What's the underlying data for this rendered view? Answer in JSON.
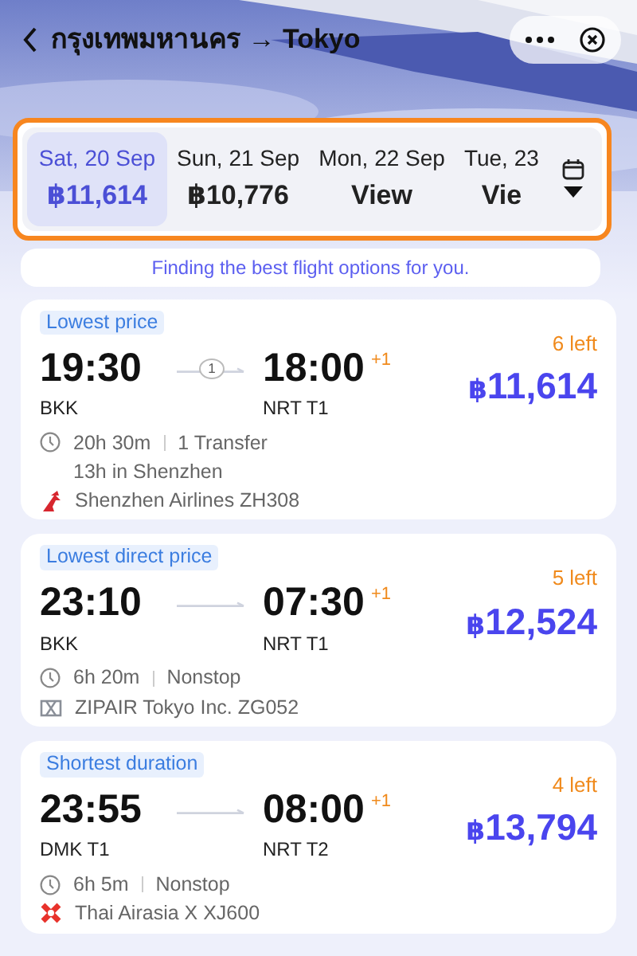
{
  "header": {
    "title": "กรุงเทพมหานคร → Tokyo"
  },
  "date_strip": {
    "highlighted": true,
    "dates": [
      {
        "date": "Sat, 20 Sep",
        "price": "฿11,614",
        "selected": true
      },
      {
        "date": "Sun, 21 Sep",
        "price": "฿10,776",
        "selected": false
      },
      {
        "date": "Mon, 22 Sep",
        "price": "View",
        "selected": false
      },
      {
        "date": "Tue, 23",
        "price": "Vie",
        "selected": false
      }
    ]
  },
  "notice": "Finding the best flight options for you.",
  "flights": [
    {
      "tag": "Lowest price",
      "depart": "19:30",
      "arrive": "18:00",
      "day_offset": "+1",
      "stops": "1",
      "from": "BKK",
      "to": "NRT T1",
      "seats": "6 left",
      "currency": "฿",
      "amount": "11,614",
      "duration": "20h 30m",
      "transfer": "1 Transfer",
      "layover": "13h in Shenzhen",
      "airline": "Shenzhen Airlines ZH308",
      "airline_logo": {
        "kind": "swoosh",
        "color": "#d7262e"
      }
    },
    {
      "tag": "Lowest direct price",
      "depart": "23:10",
      "arrive": "07:30",
      "day_offset": "+1",
      "from": "BKK",
      "to": "NRT T1",
      "seats": "5 left",
      "currency": "฿",
      "amount": "12,524",
      "duration": "6h 20m",
      "transfer": "Nonstop",
      "airline": "ZIPAIR Tokyo Inc. ZG052",
      "airline_logo": {
        "kind": "grid",
        "color": "#8a8f98"
      }
    },
    {
      "tag": "Shortest duration",
      "depart": "23:55",
      "arrive": "08:00",
      "day_offset": "+1",
      "from": "DMK T1",
      "to": "NRT T2",
      "seats": "4 left",
      "currency": "฿",
      "amount": "13,794",
      "duration": "6h 5m",
      "transfer": "Nonstop",
      "airline": "Thai Airasia X XJ600",
      "airline_logo": {
        "kind": "cross",
        "color": "#e8322b"
      }
    }
  ]
}
